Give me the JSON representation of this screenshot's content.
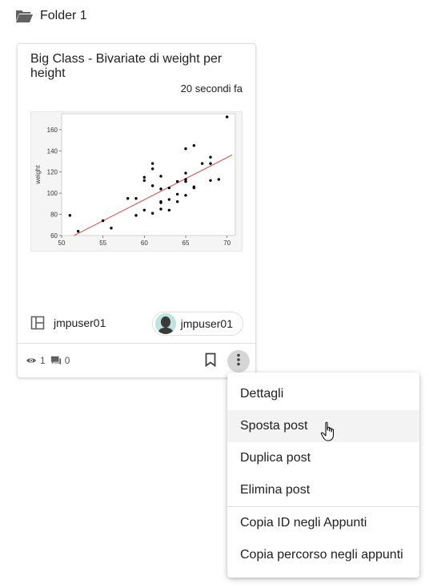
{
  "folder": {
    "icon": "folder-open-icon",
    "label": "Folder 1"
  },
  "card": {
    "title": "Big Class - Bivariate di weight per height",
    "time": "20 secondi fa",
    "author": {
      "icon": "layout-icon",
      "name": "jmpuser01"
    },
    "chip": {
      "icon": "avatar",
      "name": "jmpuser01"
    },
    "stats": {
      "views": "1",
      "comments": "0"
    }
  },
  "chart_data": {
    "type": "scatter",
    "xlabel": "",
    "ylabel": "weight",
    "xlim": [
      50,
      71
    ],
    "ylim": [
      60,
      175
    ],
    "xticks": [
      "50",
      "55",
      "60",
      "65",
      "70"
    ],
    "yticks": [
      "60",
      "80",
      "100",
      "120",
      "140",
      "160"
    ],
    "grid": false,
    "points": [
      [
        51,
        79
      ],
      [
        52,
        64
      ],
      [
        55,
        74
      ],
      [
        56,
        67
      ],
      [
        58,
        95
      ],
      [
        59,
        95
      ],
      [
        59,
        79
      ],
      [
        60,
        84
      ],
      [
        60,
        112
      ],
      [
        60,
        115
      ],
      [
        61,
        81
      ],
      [
        61,
        107
      ],
      [
        61,
        123
      ],
      [
        61,
        128
      ],
      [
        62,
        85
      ],
      [
        62,
        91
      ],
      [
        62,
        92
      ],
      [
        62,
        104
      ],
      [
        62,
        116
      ],
      [
        63,
        84
      ],
      [
        63,
        94
      ],
      [
        63,
        105
      ],
      [
        64,
        92
      ],
      [
        64,
        99
      ],
      [
        64,
        111
      ],
      [
        65,
        98
      ],
      [
        65,
        111
      ],
      [
        65,
        113
      ],
      [
        65,
        119
      ],
      [
        65,
        142
      ],
      [
        66,
        105
      ],
      [
        66,
        106
      ],
      [
        66,
        145
      ],
      [
        67,
        128
      ],
      [
        68,
        112
      ],
      [
        68,
        128
      ],
      [
        68,
        134
      ],
      [
        69,
        113
      ],
      [
        70,
        172
      ]
    ],
    "fit_line": {
      "x": [
        51.5,
        70.6
      ],
      "y": [
        60,
        136
      ],
      "color": "#d9534f"
    }
  },
  "menu": {
    "items": [
      {
        "label": "Dettagli"
      },
      {
        "label": "Sposta post"
      },
      {
        "label": "Duplica post"
      },
      {
        "label": "Elimina post"
      },
      {
        "label": "Copia ID negli Appunti"
      },
      {
        "label": "Copia percorso negli appunti"
      }
    ]
  },
  "colors": {
    "fit_line": "#d9534f",
    "avatar_bg": "#bfe3df",
    "more_button_bg": "#d6d6d6"
  }
}
